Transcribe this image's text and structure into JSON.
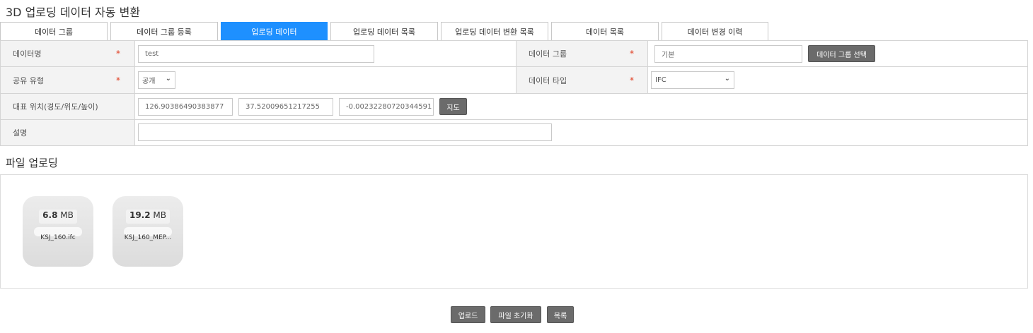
{
  "page_title": "3D 업로딩 데이터 자동 변환",
  "tabs": [
    {
      "label": "데이터 그룹",
      "active": false
    },
    {
      "label": "데이터 그룹 등록",
      "active": false
    },
    {
      "label": "업로딩 데이터",
      "active": true
    },
    {
      "label": "업로딩 데이터 목록",
      "active": false
    },
    {
      "label": "업로딩 데이터 변환 목록",
      "active": false
    },
    {
      "label": "데이터 목록",
      "active": false
    },
    {
      "label": "데이터 변경 이력",
      "active": false
    }
  ],
  "form": {
    "data_name_label": "데이터명",
    "data_name_value": "test",
    "data_group_label": "데이터 그룹",
    "data_group_value": "기본",
    "data_group_select_button": "데이터 그룹 선택",
    "share_type_label": "공유 유형",
    "share_type_value": "공개",
    "data_type_label": "데이터 타입",
    "data_type_value": "IFC",
    "location_label": "대표 위치(경도/위도/높이)",
    "longitude": "126.90386490383877",
    "latitude": "37.52009651217255",
    "altitude": "-0.00232280720344591",
    "map_button": "지도",
    "description_label": "설명",
    "description_value": "",
    "required_mark": "*"
  },
  "upload": {
    "title": "파일 업로딩",
    "files": [
      {
        "size": "6.8",
        "unit": "MB",
        "name": "KSJ_160.ifc"
      },
      {
        "size": "19.2",
        "unit": "MB",
        "name": "KSJ_160_MEP..."
      }
    ]
  },
  "actions": {
    "upload_button": "업로드",
    "reset_button": "파일 초기화",
    "list_button": "목록"
  }
}
